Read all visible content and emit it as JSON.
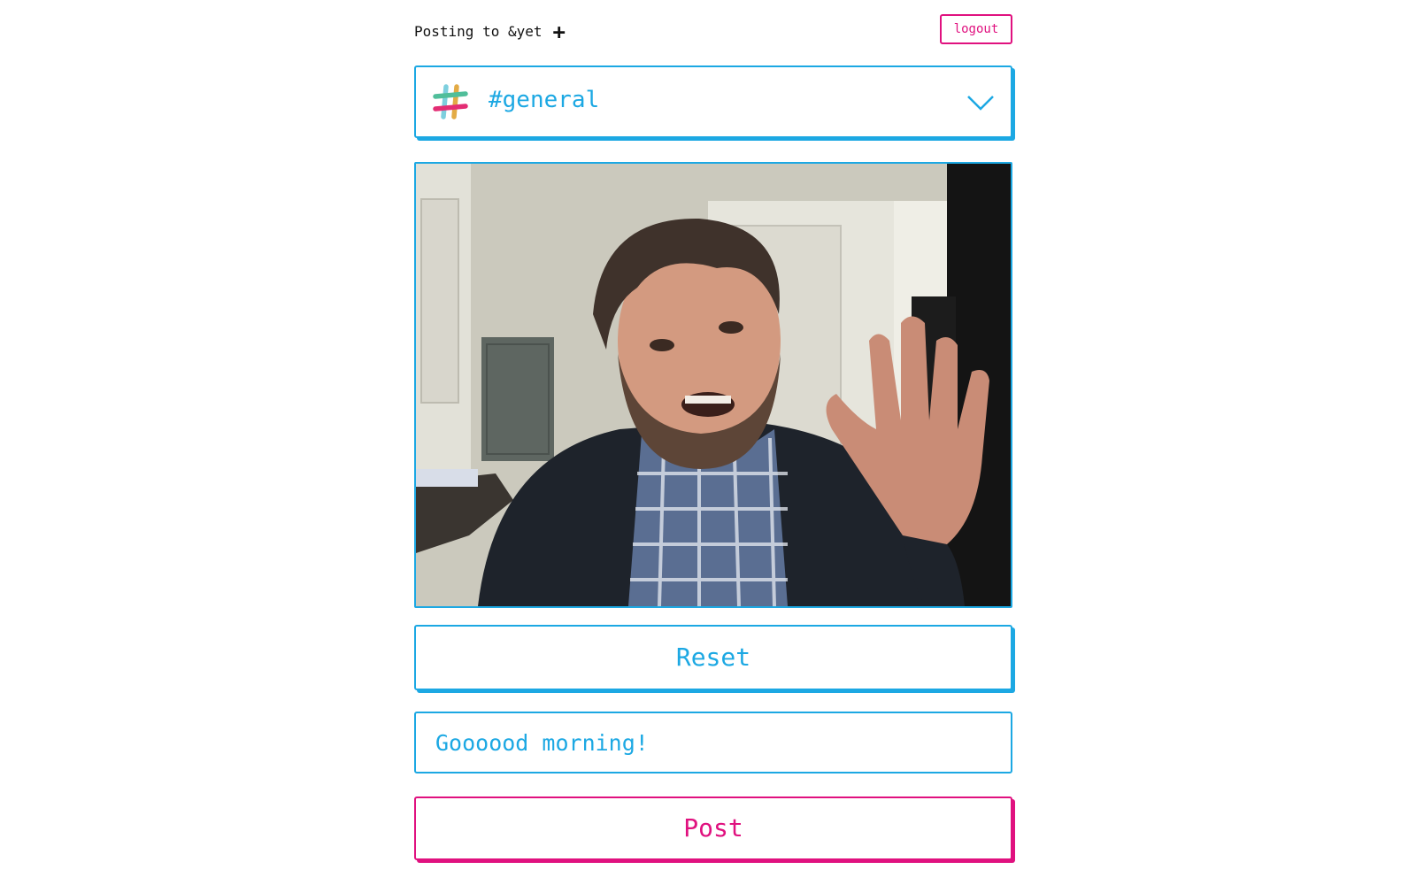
{
  "header": {
    "posting_label": "Posting to &yet",
    "add_icon": "plus-icon",
    "add_symbol": "+",
    "logout_label": "logout"
  },
  "channel_select": {
    "selected": "#general",
    "icon": "slack-logo-icon",
    "toggle_icon": "chevron-down-icon"
  },
  "photo": {
    "description_icon": "webcam-snapshot"
  },
  "actions": {
    "reset_label": "Reset",
    "post_label": "Post"
  },
  "message": {
    "value": "Goooood morning!"
  },
  "colors": {
    "accent_blue": "#1ca8e3",
    "accent_pink": "#e0117f",
    "text": "#111111"
  }
}
